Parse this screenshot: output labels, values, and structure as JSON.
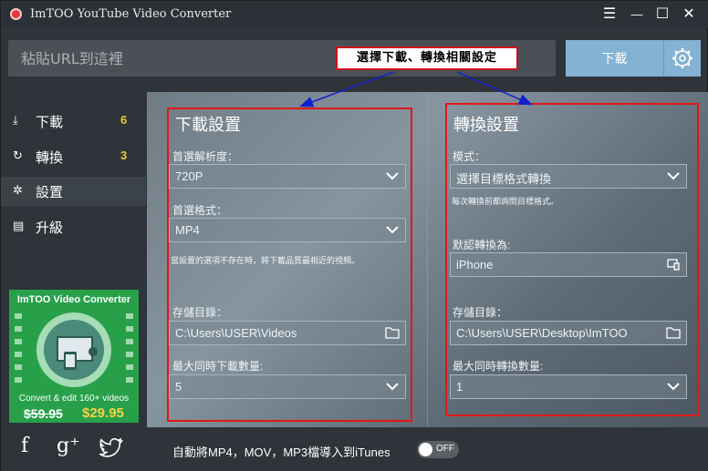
{
  "app": {
    "title": "ImTOO YouTube Video Converter"
  },
  "window_controls": {
    "menu": "☰",
    "minimize": "—",
    "maximize": "☐",
    "close": "✕"
  },
  "url": {
    "placeholder": "粘貼URL到這裡",
    "value": ""
  },
  "download_button": {
    "label": "下載"
  },
  "callout": {
    "text": "選擇下載、轉換相關設定"
  },
  "sidebar": {
    "items": [
      {
        "label": "下載",
        "count": "6",
        "icon": "download-icon"
      },
      {
        "label": "轉換",
        "count": "3",
        "icon": "convert-icon"
      },
      {
        "label": "設置",
        "count": "",
        "icon": "gear-icon"
      },
      {
        "label": "升級",
        "count": "",
        "icon": "upgrade-icon"
      }
    ]
  },
  "promo": {
    "title": "ImTOO Video Converter",
    "desc": "Convert & edit 160+ videos",
    "old_price": "$59.95",
    "new_price": "$29.95"
  },
  "social": {
    "facebook": "f",
    "googleplus": "g⁺",
    "twitter": "🐦"
  },
  "download_settings": {
    "title": "下載設置",
    "resolution_label": "首選解析度：",
    "resolution_value": "720P",
    "format_label": "首選格式：",
    "format_value": "MP4",
    "format_note": "當設置的選項不存在時，將下載品質最相近的視頻。",
    "dir_label": "存儲目錄：",
    "dir_value": "C:\\Users\\USER\\Videos",
    "max_label": "最大同時下載數量:",
    "max_value": "5"
  },
  "convert_settings": {
    "title": "轉換設置",
    "mode_label": "模式：",
    "mode_value": "選擇目標格式轉換",
    "mode_note": "每次轉換前都詢問目標格式。",
    "default_label": "默認轉換為:",
    "default_value": "iPhone",
    "dir_label": "存儲目錄：",
    "dir_value": "C:\\Users\\USER\\Desktop\\ImTOO",
    "max_label": "最大同時轉換數量:",
    "max_value": "1"
  },
  "bottom": {
    "itunes_text": "自動將MP4，MOV，MP3檔導入到iTunes",
    "toggle_label": "OFF"
  },
  "colors": {
    "accent": "#83b2d3",
    "highlight": "#e01818",
    "count": "#f3c33a",
    "promo": "#28a04a"
  }
}
